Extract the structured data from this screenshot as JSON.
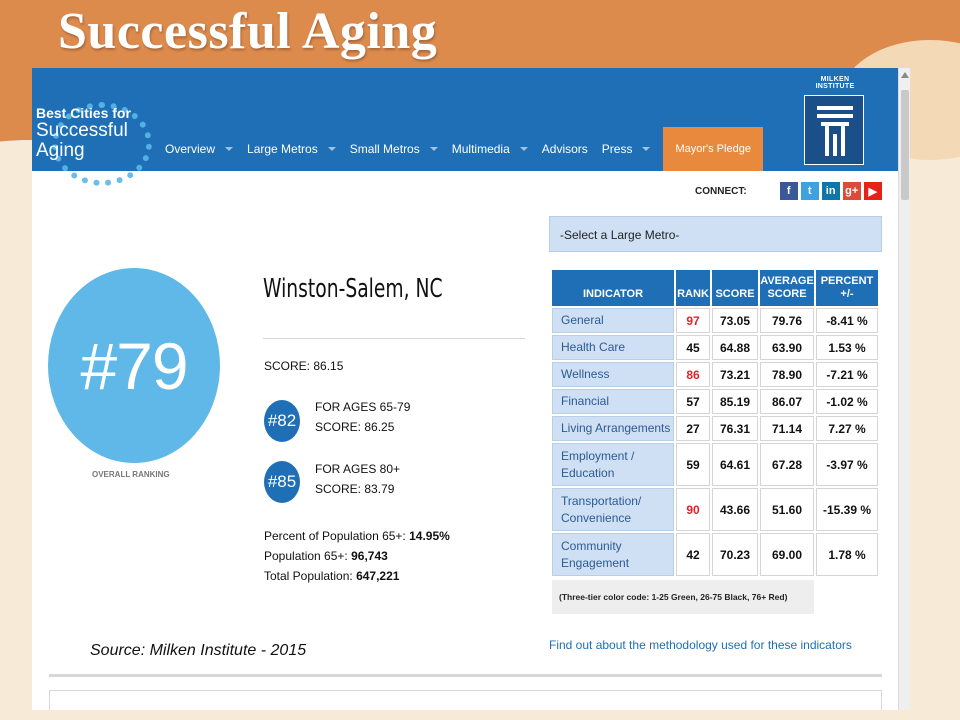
{
  "slide": {
    "title": "Successful Aging"
  },
  "header": {
    "logo_line1": "Best Cities for",
    "logo_line2": "Successful",
    "logo_line3": "Aging",
    "nav": [
      {
        "label": "Overview"
      },
      {
        "label": "Large Metros"
      },
      {
        "label": "Small Metros"
      },
      {
        "label": "Multimedia"
      },
      {
        "label": "Advisors"
      },
      {
        "label": "Press"
      },
      {
        "label": "Mayor's Pledge"
      }
    ],
    "partner_label": "MILKEN INSTITUTE"
  },
  "connect": {
    "label": "CONNECT:",
    "icons": [
      "facebook-icon",
      "twitter-icon",
      "linkedin-icon",
      "google-plus-icon",
      "youtube-icon"
    ],
    "glyphs": [
      "f",
      "t",
      "in",
      "g+",
      "▶"
    ]
  },
  "metro_select": {
    "placeholder": "-Select a Large Metro-"
  },
  "ranking": {
    "overall": "#79",
    "caption": "OVERALL RANKING",
    "city": "Winston-Salem, NC",
    "score": "SCORE: 86.15",
    "sub": [
      {
        "rank": "#82",
        "label": "FOR AGES 65-79",
        "score": "SCORE: 86.25"
      },
      {
        "rank": "#85",
        "label": "FOR AGES 80+",
        "score": "SCORE: 83.79"
      }
    ],
    "stats": [
      {
        "label": "Percent of Population 65+:",
        "value": "14.95%"
      },
      {
        "label": "Population 65+:",
        "value": "96,743"
      },
      {
        "label": "Total Population:",
        "value": "647,221"
      }
    ]
  },
  "table": {
    "headers": [
      "INDICATOR",
      "RANK",
      "SCORE",
      "AVERAGE SCORE",
      "PERCENT +/-"
    ],
    "rows": [
      {
        "indicator": "General",
        "rank": "97",
        "score": "73.05",
        "average": "79.76",
        "percent": "-8.41 %",
        "rank_color": "red"
      },
      {
        "indicator": "Health Care",
        "rank": "45",
        "score": "64.88",
        "average": "63.90",
        "percent": "1.53 %",
        "rank_color": "black"
      },
      {
        "indicator": "Wellness",
        "rank": "86",
        "score": "73.21",
        "average": "78.90",
        "percent": "-7.21 %",
        "rank_color": "red"
      },
      {
        "indicator": "Financial",
        "rank": "57",
        "score": "85.19",
        "average": "86.07",
        "percent": "-1.02 %",
        "rank_color": "black"
      },
      {
        "indicator": "Living Arrangements",
        "rank": "27",
        "score": "76.31",
        "average": "71.14",
        "percent": "7.27 %",
        "rank_color": "black"
      },
      {
        "indicator": "Employment / Education",
        "rank": "59",
        "score": "64.61",
        "average": "67.28",
        "percent": "-3.97 %",
        "rank_color": "black"
      },
      {
        "indicator": "Transportation/ Convenience",
        "rank": "90",
        "score": "43.66",
        "average": "51.60",
        "percent": "-15.39 %",
        "rank_color": "red"
      },
      {
        "indicator": "Community Engagement",
        "rank": "42",
        "score": "70.23",
        "average": "69.00",
        "percent": "1.78 %",
        "rank_color": "black"
      }
    ],
    "color_note": "(Three-tier color code: 1-25 Green, 26-75 Black, 76+ Red)"
  },
  "methodology_link": "Find out about the methodology used for these indicators",
  "source": "Source: Milken Institute - 2015",
  "colors": {
    "brand_blue": "#1e6fb6",
    "light_blue": "#5fb8e8",
    "orange": "#e8893d",
    "rank_red": "#e0242a"
  }
}
